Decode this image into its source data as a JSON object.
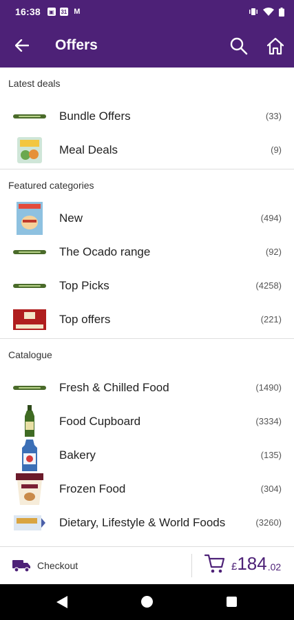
{
  "status_bar": {
    "time": "16:38",
    "calendar_day": "31",
    "left_icons": [
      "image-icon",
      "calendar-icon",
      "m-notification-icon"
    ],
    "right_icons": [
      "vibrate-icon",
      "wifi-icon",
      "battery-icon"
    ]
  },
  "app_bar": {
    "title": "Offers",
    "background": "#4d2177"
  },
  "sections": [
    {
      "header": "Latest deals",
      "items": [
        {
          "label": "Bundle Offers",
          "count": "(33)",
          "thumb": "ocado-logo"
        },
        {
          "label": "Meal Deals",
          "count": "(9)",
          "thumb": "salad-pack"
        }
      ]
    },
    {
      "header": "Featured categories",
      "items": [
        {
          "label": "New",
          "count": "(494)",
          "thumb": "magazine-cover"
        },
        {
          "label": "The Ocado range",
          "count": "(92)",
          "thumb": "ocado-logo"
        },
        {
          "label": "Top Picks",
          "count": "(4258)",
          "thumb": "ocado-logo"
        },
        {
          "label": "Top offers",
          "count": "(221)",
          "thumb": "red-biscuit-box"
        }
      ]
    },
    {
      "header": "Catalogue",
      "items": [
        {
          "label": "Fresh & Chilled Food",
          "count": "(1490)",
          "thumb": "ocado-logo"
        },
        {
          "label": "Food Cupboard",
          "count": "(3334)",
          "thumb": "oil-bottle"
        },
        {
          "label": "Bakery",
          "count": "(135)",
          "thumb": "bread-bag"
        },
        {
          "label": "Frozen Food",
          "count": "(304)",
          "thumb": "ice-cream-tub"
        },
        {
          "label": "Dietary, Lifestyle & World Foods",
          "count": "(3260)",
          "thumb": "snack-pack"
        }
      ]
    }
  ],
  "bottom_bar": {
    "checkout_label": "Checkout",
    "currency": "£",
    "pounds": "184",
    "pence": ".02",
    "accent": "#4d2177"
  }
}
